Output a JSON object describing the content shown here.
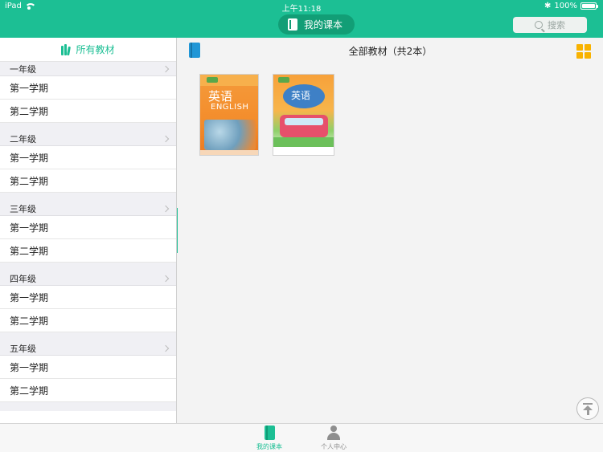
{
  "status": {
    "device": "iPad",
    "time": "上午11:18",
    "battery": "100%"
  },
  "nav": {
    "title": "我的课本",
    "search_placeholder": "搜索",
    "icon": "book-icon"
  },
  "sidebar": {
    "header": "所有教材",
    "grades": [
      {
        "label": "一年级",
        "terms": [
          "第一学期",
          "第二学期"
        ]
      },
      {
        "label": "二年级",
        "terms": [
          "第一学期",
          "第二学期"
        ]
      },
      {
        "label": "三年级",
        "terms": [
          "第一学期",
          "第二学期"
        ]
      },
      {
        "label": "四年级",
        "terms": [
          "第一学期",
          "第二学期"
        ]
      },
      {
        "label": "五年级",
        "terms": [
          "第一学期",
          "第二学期"
        ]
      }
    ]
  },
  "main": {
    "title": "全部教材（共2本）",
    "books": [
      {
        "title": "英语",
        "subtitle": "ENGLISH"
      },
      {
        "title": "英语"
      }
    ]
  },
  "tabbar": {
    "tabs": [
      {
        "label": "我的课本",
        "active": true
      },
      {
        "label": "个人中心",
        "active": false
      }
    ]
  },
  "colors": {
    "accent": "#1cbf94",
    "accent_dark": "#129e76"
  }
}
